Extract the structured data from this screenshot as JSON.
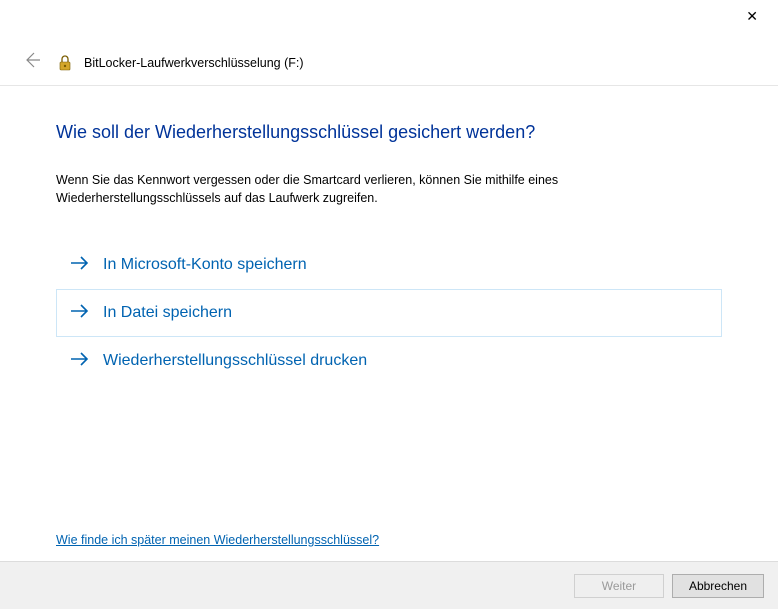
{
  "window": {
    "title": "BitLocker-Laufwerkverschlüsselung (F:)"
  },
  "heading": "Wie soll der Wiederherstellungsschlüssel gesichert werden?",
  "description": "Wenn Sie das Kennwort vergessen oder die Smartcard verlieren, können Sie mithilfe eines Wiederherstellungsschlüssels auf das Laufwerk zugreifen.",
  "options": [
    {
      "label": "In Microsoft-Konto speichern"
    },
    {
      "label": "In Datei speichern"
    },
    {
      "label": "Wiederherstellungsschlüssel drucken"
    }
  ],
  "helpLink": "Wie finde ich später meinen Wiederherstellungsschlüssel?",
  "buttons": {
    "next": "Weiter",
    "cancel": "Abbrechen"
  }
}
